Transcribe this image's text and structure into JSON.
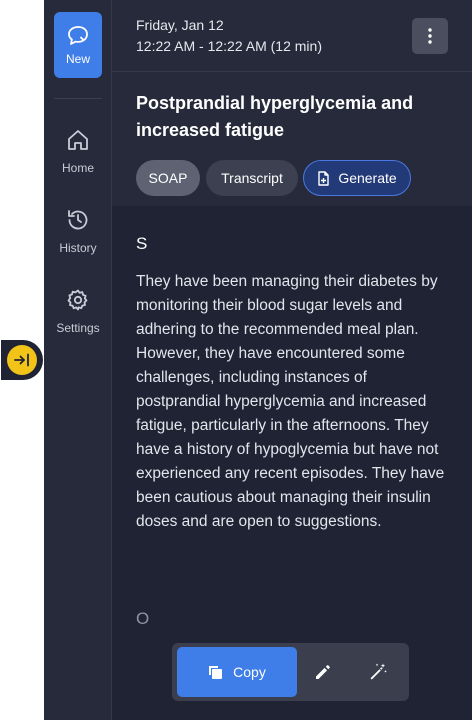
{
  "sidebar": {
    "new_label": "New",
    "items": [
      {
        "label": "Home",
        "icon": "home-icon"
      },
      {
        "label": "History",
        "icon": "history-icon"
      },
      {
        "label": "Settings",
        "icon": "gear-icon"
      }
    ]
  },
  "header": {
    "date": "Friday, Jan 12",
    "time": "12:22 AM - 12:22 AM (12 min)",
    "more_icon": "vertical-dots-icon"
  },
  "note": {
    "title": "Postprandial hyperglycemia and increased fatigue",
    "tabs": [
      "SOAP",
      "Transcript",
      "Generate"
    ],
    "active_tab": "SOAP"
  },
  "content": {
    "section_s": "S",
    "subjective_text": "They have been managing their diabetes by monitoring their blood sugar levels and adhering to the recommended meal plan. However, they have encountered some challenges, including instances of postprandial hyperglycemia and increased fatigue, particularly in the afternoons. They have a history of hypoglycemia but have not experienced any recent episodes. They have been cautious about managing their insulin doses and are open to suggestions.",
    "section_o": "O"
  },
  "actions": {
    "copy_label": "Copy",
    "edit_icon": "pencil-icon",
    "magic_icon": "magic-wand-icon"
  },
  "colors": {
    "accent": "#3f7de8",
    "toggle": "#f2c418",
    "background": "#1f2333",
    "panel": "#262a3a"
  }
}
